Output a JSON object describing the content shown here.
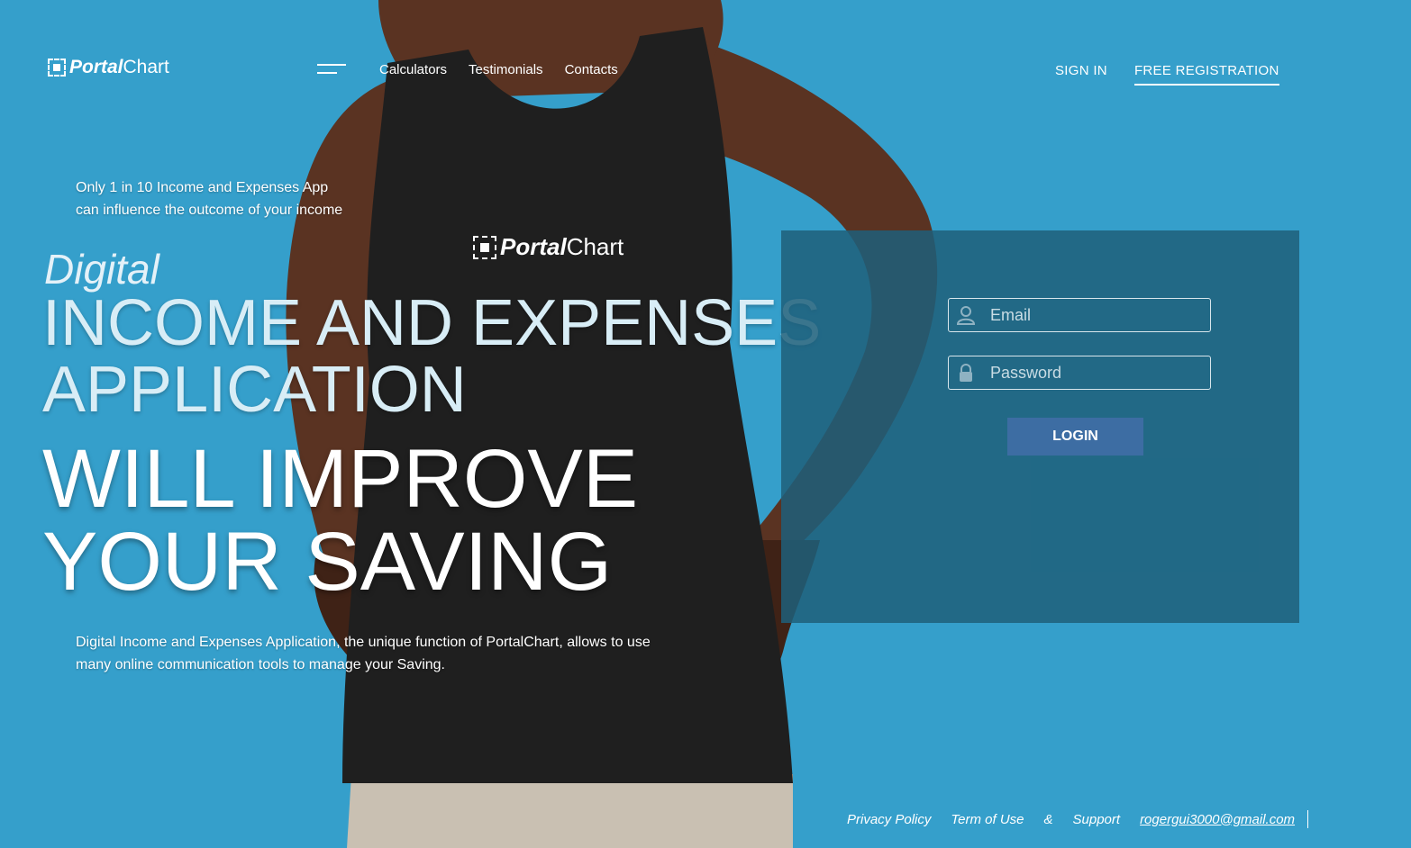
{
  "brand": {
    "logo_strong": "Portal",
    "logo_light": "Chart"
  },
  "nav": {
    "items": [
      {
        "label": "Calculators"
      },
      {
        "label": "Testimonials"
      },
      {
        "label": "Contacts"
      }
    ],
    "sign_in": "SIGN IN",
    "free_registration": "FREE REGISTRATION"
  },
  "hero": {
    "tagline": "Only 1 in 10 Income and Expenses App can influence the outcome of your income",
    "digital": "Digital",
    "headline_line1": "INCOME AND EXPENSES",
    "headline_line2": "APPLICATION",
    "headline_big1": "WILL IMPROVE",
    "headline_big2": "YOUR SAVING",
    "description": "Digital Income and Expenses Application, the unique function of PortalChart, allows to use many online communication tools to manage your Saving."
  },
  "login": {
    "email_placeholder": "Email",
    "password_placeholder": "Password",
    "button_label": "LOGIN"
  },
  "footer": {
    "privacy": "Privacy Policy",
    "terms": "Term of Use",
    "amp": "&",
    "support": "Support",
    "email": "rogergui3000@gmail.com"
  },
  "colors": {
    "background": "#359fcb",
    "panel": "#1e5f7a",
    "button": "#3d6da3",
    "shirt": "#1f1f1f"
  },
  "icons": {
    "email_field": "user-icon",
    "password_field": "lock-icon",
    "menu": "hamburger-icon"
  }
}
